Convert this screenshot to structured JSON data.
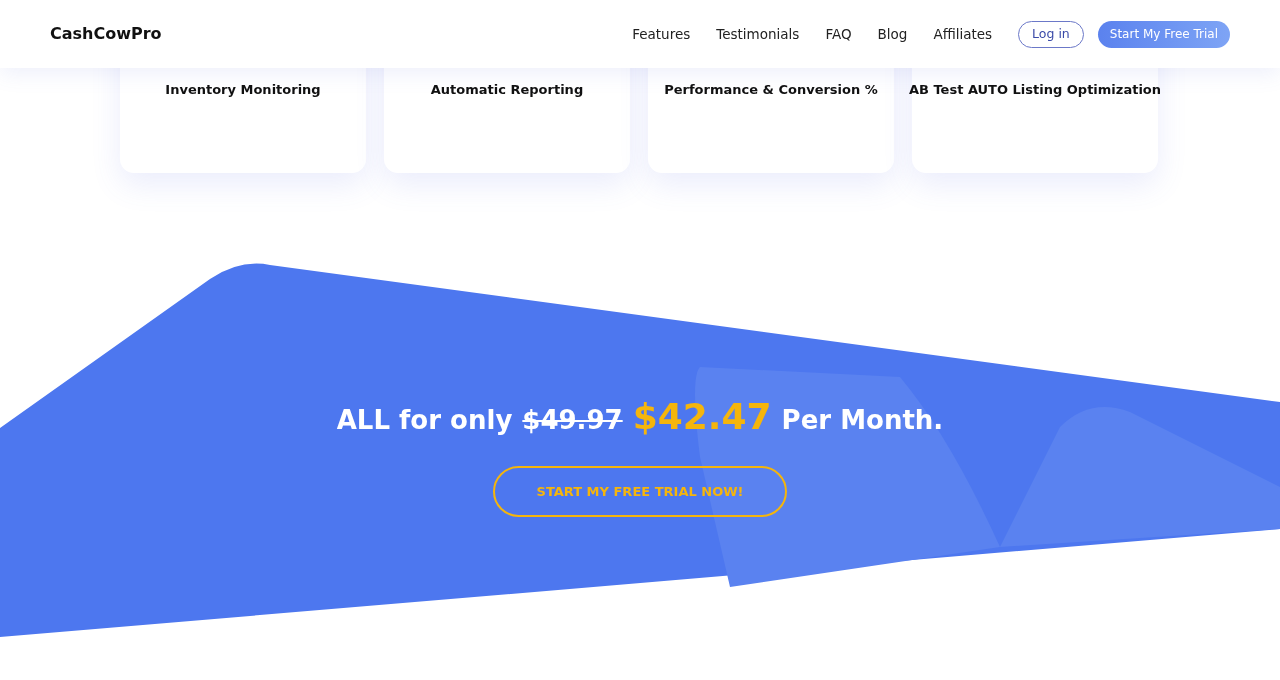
{
  "header": {
    "logo": "CashCowPro",
    "nav": [
      "Features",
      "Testimonials",
      "FAQ",
      "Blog",
      "Affiliates"
    ],
    "login": "Log in",
    "cta": "Start My Free Trial"
  },
  "features": [
    {
      "title": "Inventory Monitoring"
    },
    {
      "title": "Automatic Reporting"
    },
    {
      "title": "Performance & Conversion %"
    },
    {
      "title": "AB Test AUTO Listing Optimization"
    }
  ],
  "pricing": {
    "lead": "ALL for only",
    "old_price": "$49.97",
    "new_price": "$42.47",
    "suffix": "Per Month.",
    "button": "START MY FREE TRIAL NOW!"
  }
}
